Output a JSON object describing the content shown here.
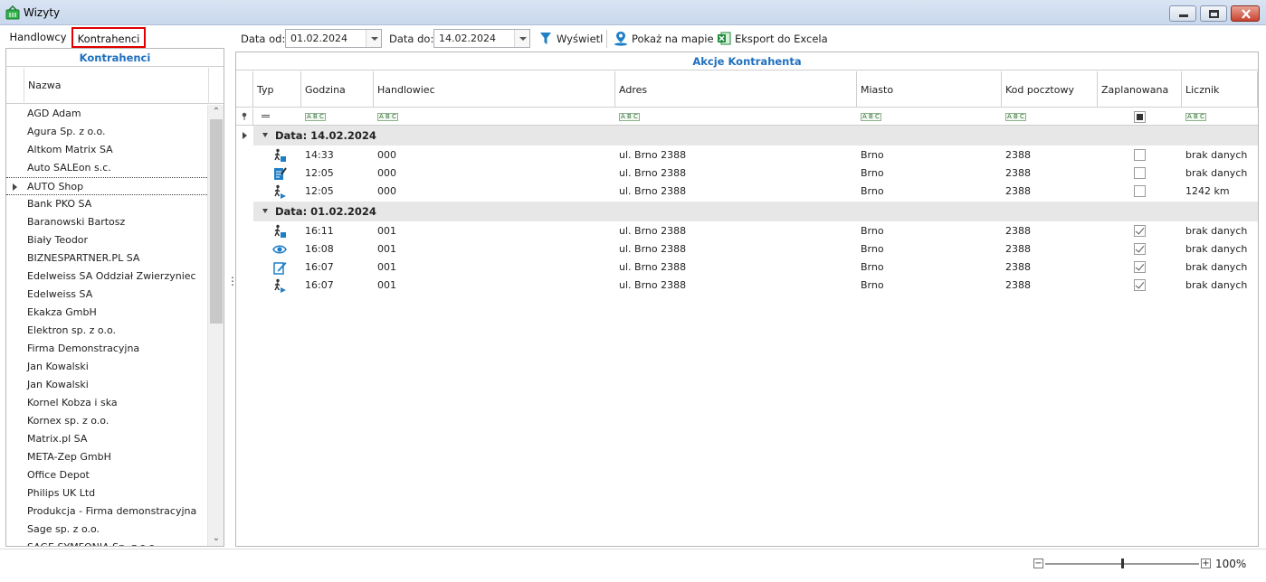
{
  "window": {
    "title": "Wizyty"
  },
  "tabs": [
    {
      "label": "Handlowcy"
    },
    {
      "label": "Kontrahenci"
    }
  ],
  "left_panel": {
    "title": "Kontrahenci",
    "column": "Nazwa",
    "items": [
      "AGD Adam",
      "Agura Sp. z o.o.",
      "Altkom Matrix SA",
      "Auto SALEon s.c.",
      "AUTO Shop",
      "Bank PKO SA",
      "Baranowski Bartosz",
      "Biały Teodor",
      "BIZNESPARTNER.PL SA",
      "Edelweiss SA Oddział Zwierzyniec",
      "Edelweiss SA",
      "Ekakza GmbH",
      "Elektron sp. z o.o.",
      "Firma Demonstracyjna",
      "Jan Kowalski",
      "Jan Kowalski",
      "Kornel Kobza i ska",
      "Kornex sp. z o.o.",
      "Matrix.pl SA",
      "META-Zep GmbH",
      "Office Depot",
      "Philips UK Ltd",
      "Produkcja - Firma demonstracyjna",
      "Sage sp. z o.o.",
      "SAGE SYMFONIA Sp. z o.o."
    ],
    "selected_index": 4
  },
  "toolbar": {
    "date_from_label": "Data od:",
    "date_from_value": "01.02.2024",
    "date_to_label": "Data do:",
    "date_to_value": "14.02.2024",
    "show_label": "Wyświetl",
    "map_label": "Pokaż na mapie",
    "excel_label": "Eksport do Excela"
  },
  "grid": {
    "title": "Akcje Kontrahenta",
    "columns": [
      "Typ",
      "Godzina",
      "Handlowiec",
      "Adres",
      "Miasto",
      "Kod pocztowy",
      "Zaplanowana",
      "Licznik"
    ],
    "groups": [
      {
        "label": "Data: 14.02.2024",
        "rows": [
          {
            "icon": "walking-person-icon",
            "time": "14:33",
            "salesman": "000",
            "address": "ul.  Brno 2388",
            "city": "Brno",
            "postal": "2388",
            "planned": false,
            "counter": "brak danych"
          },
          {
            "icon": "note-edit-icon",
            "time": "12:05",
            "salesman": "000",
            "address": "ul.  Brno 2388",
            "city": "Brno",
            "postal": "2388",
            "planned": false,
            "counter": "brak danych"
          },
          {
            "icon": "walking-arrow-icon",
            "time": "12:05",
            "salesman": "000",
            "address": "ul.  Brno 2388",
            "city": "Brno",
            "postal": "2388",
            "planned": false,
            "counter": "1242 km"
          }
        ]
      },
      {
        "label": "Data: 01.02.2024",
        "rows": [
          {
            "icon": "walking-person-icon",
            "time": "16:11",
            "salesman": "001",
            "address": "ul.  Brno 2388",
            "city": "Brno",
            "postal": "2388",
            "planned": true,
            "counter": "brak danych"
          },
          {
            "icon": "eye-icon",
            "time": "16:08",
            "salesman": "001",
            "address": "ul.  Brno 2388",
            "city": "Brno",
            "postal": "2388",
            "planned": true,
            "counter": "brak danych"
          },
          {
            "icon": "pencil-note-icon",
            "time": "16:07",
            "salesman": "001",
            "address": "ul.  Brno 2388",
            "city": "Brno",
            "postal": "2388",
            "planned": true,
            "counter": "brak danych"
          },
          {
            "icon": "walking-arrow-icon",
            "time": "16:07",
            "salesman": "001",
            "address": "ul.  Brno 2388",
            "city": "Brno",
            "postal": "2388",
            "planned": true,
            "counter": "brak danych"
          }
        ]
      }
    ]
  },
  "status": {
    "zoom": "100%",
    "zoom_level": 0.5
  },
  "colors": {
    "accent": "#1f6fbf",
    "highlight": "#e00000",
    "group_bg": "#e7e7e7"
  }
}
